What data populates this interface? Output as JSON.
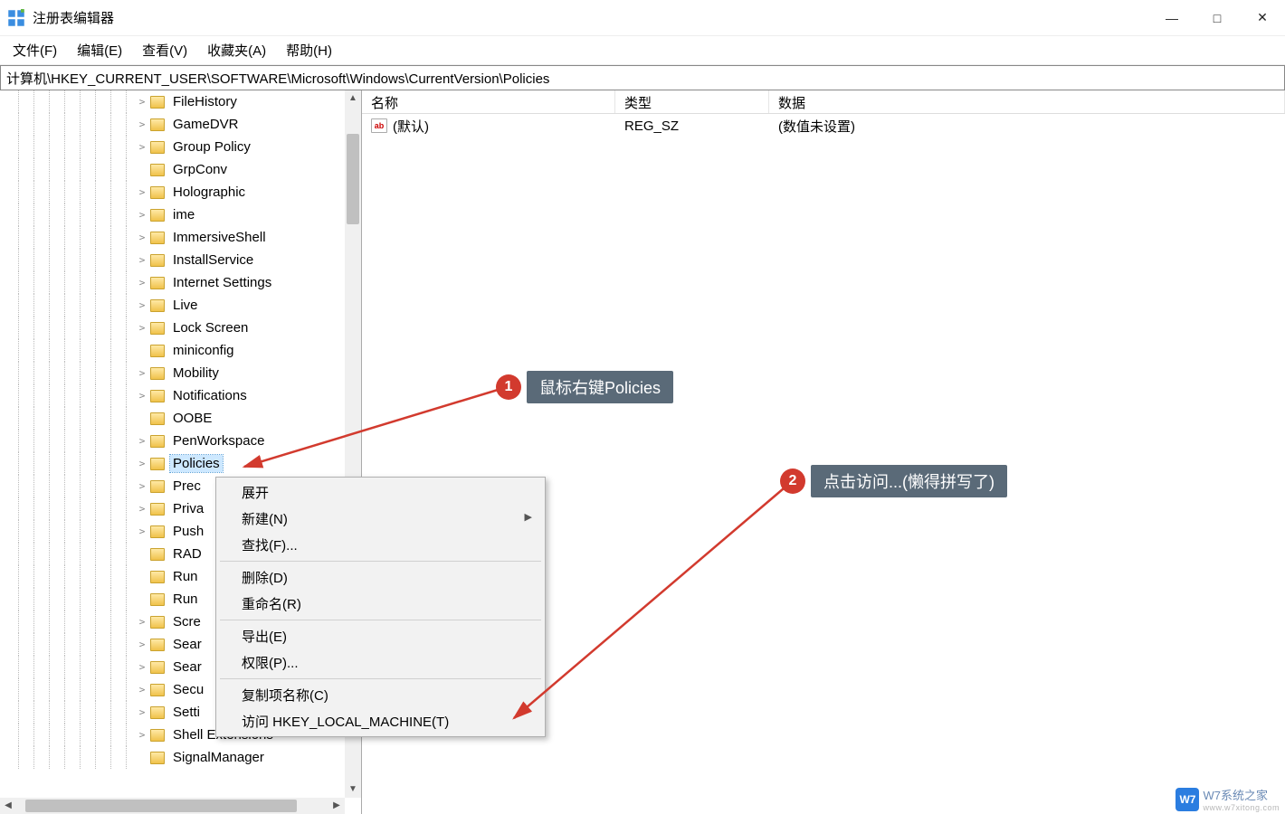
{
  "window": {
    "title": "注册表编辑器"
  },
  "menu": {
    "file": "文件(F)",
    "edit": "编辑(E)",
    "view": "查看(V)",
    "fav": "收藏夹(A)",
    "help": "帮助(H)"
  },
  "addressbar": {
    "path": "计算机\\HKEY_CURRENT_USER\\SOFTWARE\\Microsoft\\Windows\\CurrentVersion\\Policies"
  },
  "tree": {
    "items": [
      {
        "label": "FileHistory",
        "expandable": true
      },
      {
        "label": "GameDVR",
        "expandable": true
      },
      {
        "label": "Group Policy",
        "expandable": true
      },
      {
        "label": "GrpConv",
        "expandable": false
      },
      {
        "label": "Holographic",
        "expandable": true
      },
      {
        "label": "ime",
        "expandable": true
      },
      {
        "label": "ImmersiveShell",
        "expandable": true
      },
      {
        "label": "InstallService",
        "expandable": true
      },
      {
        "label": "Internet Settings",
        "expandable": true
      },
      {
        "label": "Live",
        "expandable": true
      },
      {
        "label": "Lock Screen",
        "expandable": true
      },
      {
        "label": "miniconfig",
        "expandable": false
      },
      {
        "label": "Mobility",
        "expandable": true
      },
      {
        "label": "Notifications",
        "expandable": true
      },
      {
        "label": "OOBE",
        "expandable": false
      },
      {
        "label": "PenWorkspace",
        "expandable": true
      },
      {
        "label": "Policies",
        "expandable": true,
        "selected": true
      },
      {
        "label": "PrecisionTouchPad",
        "expandable": true,
        "truncated": "Prec"
      },
      {
        "label": "Privacy",
        "expandable": true,
        "truncated": "Priva"
      },
      {
        "label": "PushNotifications",
        "expandable": true,
        "truncated": "Push"
      },
      {
        "label": "RADAR",
        "expandable": false,
        "truncated": "RAD"
      },
      {
        "label": "Run",
        "expandable": false,
        "truncated": "Run"
      },
      {
        "label": "RunOnce",
        "expandable": false,
        "truncated": "Run"
      },
      {
        "label": "Screensavers",
        "expandable": true,
        "truncated": "Scre"
      },
      {
        "label": "Search",
        "expandable": true,
        "truncated": "Sear"
      },
      {
        "label": "SearchSettings",
        "expandable": true,
        "truncated": "Sear"
      },
      {
        "label": "Security and Maintenance",
        "expandable": true,
        "truncated": "Secu"
      },
      {
        "label": "SettingSync",
        "expandable": true,
        "truncated": "Setti"
      },
      {
        "label": "Shell Extensions",
        "expandable": true
      },
      {
        "label": "SignalManager",
        "expandable": false,
        "truncated": "Si"
      }
    ]
  },
  "list": {
    "cols": {
      "name": "名称",
      "type": "类型",
      "data": "数据"
    },
    "rows": [
      {
        "name": "(默认)",
        "type": "REG_SZ",
        "data": "(数值未设置)"
      }
    ]
  },
  "context_menu": {
    "expand": "展开",
    "new": "新建(N)",
    "find": "查找(F)...",
    "delete": "删除(D)",
    "rename": "重命名(R)",
    "export": "导出(E)",
    "perm": "权限(P)...",
    "copyname": "复制项名称(C)",
    "goto": "访问 HKEY_LOCAL_MACHINE(T)"
  },
  "annotations": {
    "n1": "1",
    "t1": "鼠标右键Policies",
    "n2": "2",
    "t2": "点击访问...(懒得拼写了)"
  },
  "watermark": {
    "brand": "W7",
    "text": "W7系统之家",
    "sub": "www.w7xitong.com"
  }
}
